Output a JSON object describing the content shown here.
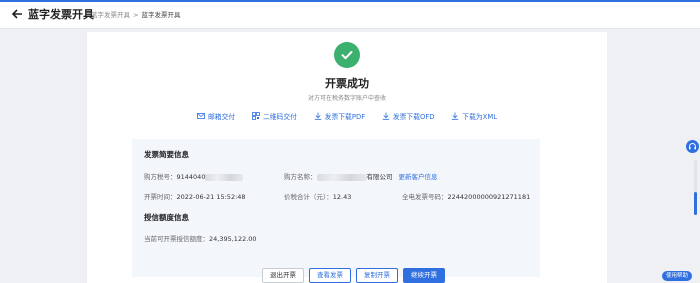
{
  "header": {
    "title": "蓝字发票开具",
    "breadcrumb": [
      "蓝字发票开具",
      ">",
      "蓝字发票开具"
    ]
  },
  "result": {
    "title": "开票成功",
    "subtitle": "对方可在税务数字账户中查收",
    "status_color": "#3cb06f"
  },
  "actions": [
    {
      "icon": "mail-icon",
      "label": "邮箱交付"
    },
    {
      "icon": "qrcode-icon",
      "label": "二维码交付"
    },
    {
      "icon": "download-icon",
      "label": "发票下载PDF"
    },
    {
      "icon": "download-icon",
      "label": "发票下载OFD"
    },
    {
      "icon": "download-icon",
      "label": "下载为XML"
    }
  ],
  "summary": {
    "section_title": "发票简要信息",
    "buyer_tax_no_label": "购方税号：",
    "buyer_tax_no_value": "9144040",
    "buyer_name_label": "购方名称：",
    "buyer_name_value": "有限公司",
    "update_client_link": "更新客户信息",
    "issue_time_label": "开票时间：",
    "issue_time_value": "2022-06-21 15:52:48",
    "total_label": "价税合计（元）：",
    "total_value": "12.43",
    "invoice_no_label": "全电发票号码：",
    "invoice_no_value": "22442000000921271181"
  },
  "credit": {
    "section_title": "授信额度信息",
    "label": "当前可开票授信额度：",
    "value": "24,395,122.00"
  },
  "buttons": {
    "exit": "退出开票",
    "view": "查看发票",
    "copy": "复制开票",
    "continue": "继续开票"
  },
  "help_label": "使用帮助",
  "brand_color": "#2f6fe0"
}
